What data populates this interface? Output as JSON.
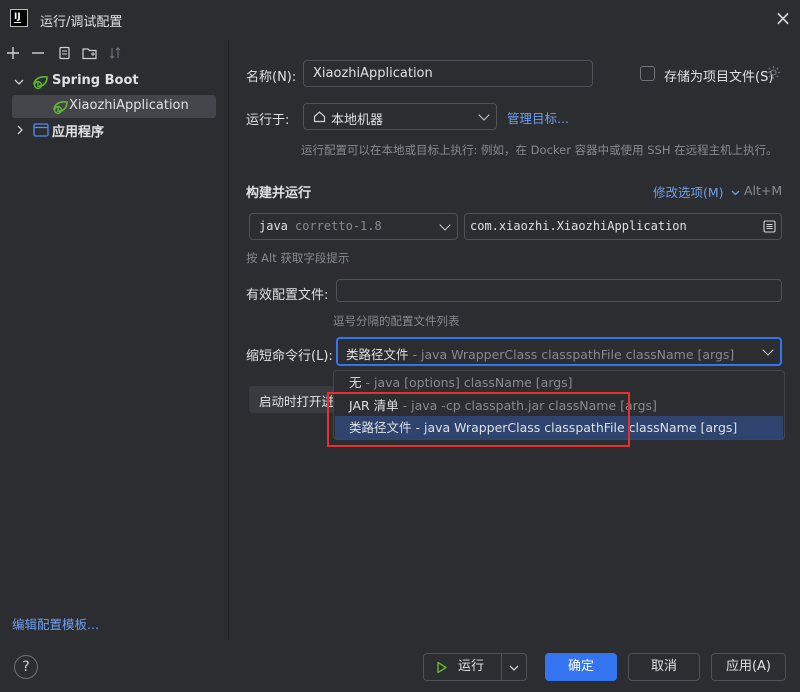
{
  "window": {
    "title": "运行/调试配置",
    "logo": "IJ"
  },
  "toolbar": {
    "icons": [
      "add-icon",
      "remove-icon",
      "copy-icon",
      "new-folder-icon",
      "sort-icon"
    ]
  },
  "tree": {
    "group": "Spring Boot",
    "item": "XiaozhiApplication",
    "group2": "应用程序"
  },
  "edit_templates": "编辑配置模板...",
  "form": {
    "name_label": "名称(N):",
    "name_value": "XiaozhiApplication",
    "store_label": "存储为项目文件(S)",
    "run_on_label": "运行于:",
    "run_on_value": "本地机器",
    "manage_targets": "管理目标...",
    "run_on_hint": "运行配置可以在本地或目标上执行: 例如，在 Docker 容器中或使用 SSH 在远程主机上执行。",
    "build_run_label": "构建并运行",
    "modify_options": "修改选项(M)",
    "modify_shortcut": "Alt+M",
    "jdk_java": "java",
    "jdk_version": "corretto-1.8",
    "main_class": "com.xiaozhi.XiaozhiApplication",
    "field_hint": "按 Alt 获取字段提示",
    "active_profiles_label": "有效配置文件:",
    "active_profiles_value": "",
    "active_profiles_hint": "逗号分隔的配置文件列表",
    "shorten_label": "缩短命令行(L):",
    "shorten_value_main": "类路径文件",
    "shorten_value_sub": " - java WrapperClass classpathFile className [args]",
    "open_browser_partial": "启动时打开迸"
  },
  "dropdown": {
    "items": [
      {
        "main": "无",
        "sub": " - java [options] className [args]"
      },
      {
        "main": "JAR 清单",
        "sub": " - java -cp classpath.jar className [args]"
      },
      {
        "main": "类路径文件",
        "sub": " - java WrapperClass classpathFile className [args]"
      }
    ],
    "selected_index": 2
  },
  "buttons": {
    "help": "?",
    "run": "运行",
    "ok": "确定",
    "cancel": "取消",
    "apply": "应用(A)"
  },
  "colors": {
    "background": "#2b2d30",
    "accent": "#3574f0",
    "link": "#6d9eef",
    "selection": "#2e436e",
    "annotation": "#e5302f",
    "spring": "#5fb832"
  }
}
